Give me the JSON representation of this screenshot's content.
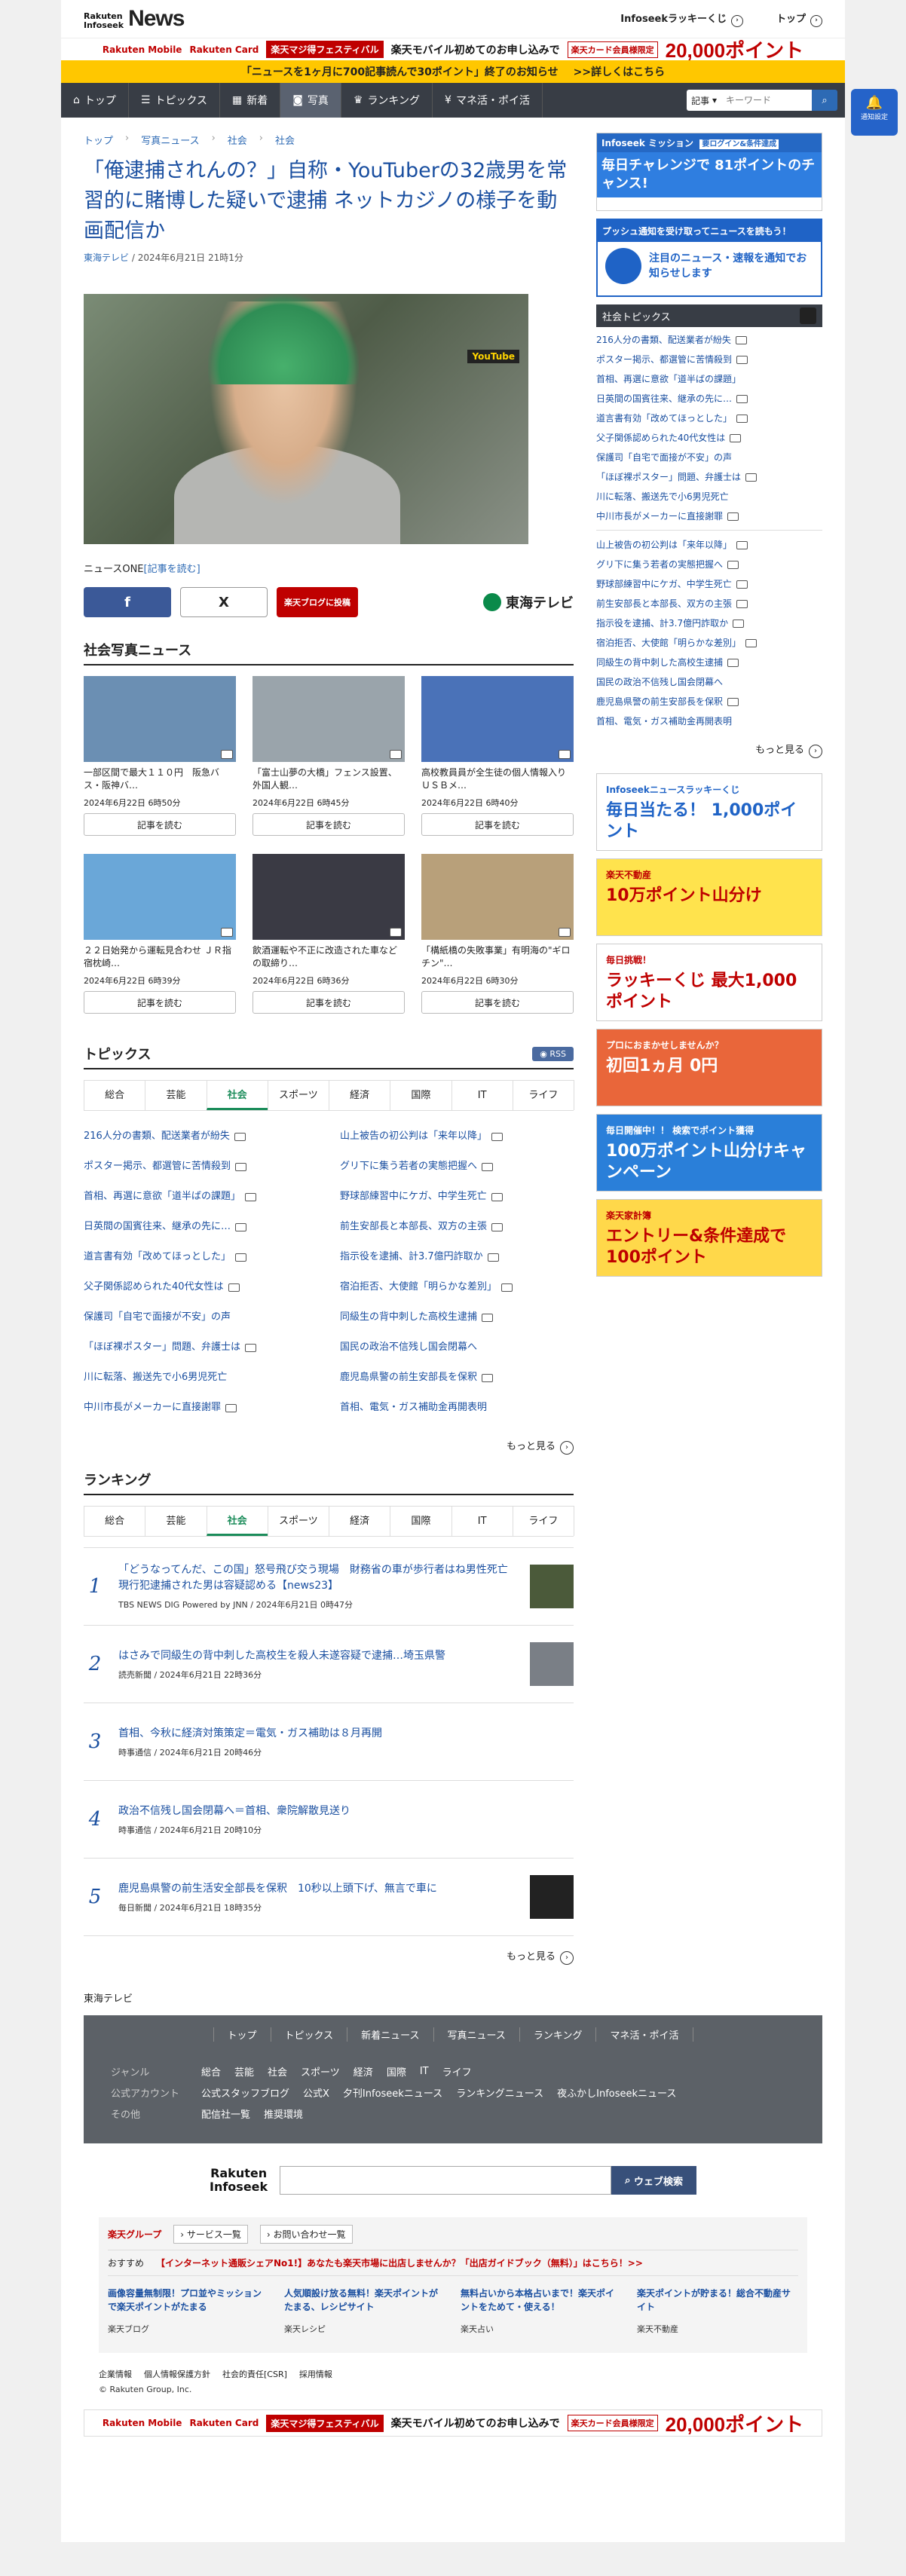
{
  "header": {
    "logo_top": "Rakuten\nInfoseek",
    "logo_news": "News",
    "kuji": "Infoseekラッキーくじ",
    "top": "トップ"
  },
  "banner": {
    "logo1": "Rakuten Mobile",
    "logo2": "Rakuten Card",
    "fest": "楽天マジ得フェスティバル",
    "text": "楽天モバイル初めてのお申し込みで",
    "box": "楽天カード会員様限定",
    "points": "20,000ポイント"
  },
  "yellowbar": {
    "text": "「ニュースを1ヶ月に700記事読んで30ポイント」終了のお知らせ",
    "link": ">>詳しくはこちら"
  },
  "nav": {
    "items": [
      "トップ",
      "トピックス",
      "新着",
      "写真",
      "ランキング",
      "マネ活・ポイ活"
    ],
    "active": 3,
    "search_select": "記事",
    "search_placeholder": "キーワード"
  },
  "notification": {
    "label": "通知設定"
  },
  "breadcrumb": [
    "トップ",
    "写真ニュース",
    "社会",
    "社会"
  ],
  "article": {
    "title": "「俺逮捕されんの？」自称・YouTuberの32歳男を常習的に賭博した疑いで逮捕 ネットカジノの様子を動画配信か",
    "source": "東海テレビ",
    "date": " / 2024年6月21日 21時1分",
    "photo_badge": "YouTube",
    "caption": "ニュースONE",
    "caption_link": "[記事を読む]",
    "share_fb": "f",
    "share_x": "X",
    "share_blog": "楽天ブログに投稿",
    "publisher": "東海テレビ"
  },
  "photo_news": {
    "heading": "社会写真ニュース",
    "read_label": "記事を読む",
    "items": [
      {
        "title": "一部区間で最大１１０円　阪急バス・阪神バ…",
        "date": "2024年6月22日 6時50分",
        "color": "#6b8fb3"
      },
      {
        "title": "「富士山夢の大橋」フェンス設置、外国人観…",
        "date": "2024年6月22日 6時45分",
        "color": "#9aa4ab"
      },
      {
        "title": "高校教員員が全生徒の個人情報入りＵＳＢメ…",
        "date": "2024年6月22日 6時40分",
        "color": "#4a72b8"
      },
      {
        "title": "２２日始発から運転見合わせ ＪＲ指宿枕崎…",
        "date": "2024年6月22日 6時39分",
        "color": "#6aa7d8"
      },
      {
        "title": "飲酒運転や不正に改造された車などの取締り…",
        "date": "2024年6月22日 6時36分",
        "color": "#3a3a44"
      },
      {
        "title": "「構紙橋の失敗事業」有明海の\"ギロチン\"…",
        "date": "2024年6月22日 6時30分",
        "color": "#b8a07a"
      }
    ]
  },
  "topics": {
    "heading": "トピックス",
    "rss": "RSS",
    "tabs": [
      "総合",
      "芸能",
      "社会",
      "スポーツ",
      "経済",
      "国際",
      "IT",
      "ライフ"
    ],
    "active_tab": 2,
    "items": [
      {
        "text": "216人分の書類、配送業者が紛失",
        "cam": true
      },
      {
        "text": "山上被告の初公判は「来年以降」",
        "cam": true
      },
      {
        "text": "ポスター掲示、都選管に苦情殺到",
        "cam": true
      },
      {
        "text": "グリ下に集う若者の実態把握へ",
        "cam": true
      },
      {
        "text": "首相、再選に意欲「道半ばの課題」",
        "cam": true
      },
      {
        "text": "野球部練習中にケガ、中学生死亡",
        "cam": true
      },
      {
        "text": "日英間の国賓往来、継承の先に…",
        "cam": true
      },
      {
        "text": "前生安部長と本部長、双方の主張",
        "cam": true
      },
      {
        "text": "道言書有効「改めてほっとした」",
        "cam": true
      },
      {
        "text": "指示役を逮捕、計3.7億円詐取か",
        "cam": true
      },
      {
        "text": "父子関係認められた40代女性は",
        "cam": true
      },
      {
        "text": "宿泊拒否、大使館「明らかな差別」",
        "cam": true
      },
      {
        "text": "保護司「自宅で面接が不安」の声",
        "cam": false
      },
      {
        "text": "同級生の背中刺した高校生逮捕",
        "cam": true
      },
      {
        "text": "「ほぼ裸ポスター」問題、弁護士は",
        "cam": true
      },
      {
        "text": "国民の政治不信残し国会閉幕へ",
        "cam": false
      },
      {
        "text": "川に転落、搬送先で小6男児死亡",
        "cam": false
      },
      {
        "text": "鹿児島県警の前生安部長を保釈",
        "cam": true
      },
      {
        "text": "中川市長がメーカーに直接謝罪",
        "cam": true
      },
      {
        "text": "首相、電気・ガス補助金再開表明",
        "cam": false
      }
    ],
    "more": "もっと見る"
  },
  "ranking": {
    "heading": "ランキング",
    "tabs": [
      "総合",
      "芸能",
      "社会",
      "スポーツ",
      "経済",
      "国際",
      "IT",
      "ライフ"
    ],
    "active_tab": 2,
    "items": [
      {
        "rank": "1",
        "title": "「どうなってんだ、この国」怒号飛び交う現場　財務省の車が歩行者はね男性死亡　現行犯逮捕された男は容疑認める【news23】",
        "meta": "TBS NEWS DIG Powered by JNN / 2024年6月21日 0時47分",
        "thumb": "#4b5a3a"
      },
      {
        "rank": "2",
        "title": "はさみで同級生の背中刺した高校生を殺人未遂容疑で逮捕…埼玉県警",
        "meta": "読売新聞 / 2024年6月21日 22時36分",
        "thumb": "#7a7f86"
      },
      {
        "rank": "3",
        "title": "首相、今秋に経済対策策定＝電気・ガス補助は８月再開",
        "meta": "時事通信 / 2024年6月21日 20時46分",
        "thumb": ""
      },
      {
        "rank": "4",
        "title": "政治不信残し国会閉幕へ＝首相、衆院解散見送り",
        "meta": "時事通信 / 2024年6月21日 20時10分",
        "thumb": ""
      },
      {
        "rank": "5",
        "title": "鹿児島県警の前生活安全部長を保釈　10秒以上頭下げ、無言で車に",
        "meta": "毎日新聞 / 2024年6月21日 18時35分",
        "thumb": "#222"
      }
    ],
    "more": "もっと見る"
  },
  "source_footer": "東海テレビ",
  "sidebar": {
    "ad1_top": "Infoseek ミッション",
    "ad1_badge": "要ログイン&条件達成",
    "ad1_main": "毎日チャレンジで 81ポイントのチャンス!",
    "ad2_top": "プッシュ通知を受け取ってニュースを読もう！",
    "ad2_main": "注目のニュース・速報を通知でお知らせします",
    "topics_heading": "社会トピックス",
    "topics": [
      "216人分の書類、配送業者が紛失",
      "ポスター掲示、都選管に苦情殺到",
      "首相、再選に意欲「道半ばの課題」",
      "日英間の国賓往来、継承の先に…",
      "道言書有効「改めてほっとした」",
      "父子関係認められた40代女性は",
      "保護司「自宅で面接が不安」の声",
      "「ほぼ裸ポスター」問題、弁護士は",
      "川に転落、搬送先で小6男児死亡",
      "中川市長がメーカーに直接謝罪",
      "山上被告の初公判は「来年以降」",
      "グリ下に集う若者の実態把握へ",
      "野球部練習中にケガ、中学生死亡",
      "前生安部長と本部長、双方の主張",
      "指示役を逮捕、計3.7億円詐取か",
      "宿泊拒否、大使館「明らかな差別」",
      "同級生の背中刺した高校生逮捕",
      "国民の政治不信残し国会閉幕へ",
      "鹿児島県警の前生安部長を保釈",
      "首相、電気・ガス補助金再開表明"
    ],
    "topics_cam": [
      true,
      true,
      false,
      true,
      true,
      true,
      false,
      true,
      false,
      true,
      true,
      true,
      true,
      true,
      true,
      true,
      true,
      false,
      true,
      false
    ],
    "more": "もっと見る",
    "ads": [
      {
        "main": "毎日当たる！ 1,000ポイント",
        "sub": "Infoseekニュースラッキーくじ",
        "bg": "#fff",
        "fg": "#1f63c6"
      },
      {
        "main": "10万ポイント山分け",
        "sub": "楽天不動産",
        "bg": "#ffe34d",
        "fg": "#bf0000"
      },
      {
        "main": "ラッキーくじ 最大1,000ポイント",
        "sub": "毎日挑戦！",
        "bg": "#fff",
        "fg": "#bf0000"
      },
      {
        "main": "初回1ヵ月 0円",
        "sub": "プロにおまかせしませんか？",
        "bg": "#e9663a",
        "fg": "#fff"
      },
      {
        "main": "100万ポイント山分けキャンペーン",
        "sub": "毎日開催中！！ 検索でポイント獲得",
        "bg": "#2a7fd9",
        "fg": "#fff"
      },
      {
        "main": "エントリー&条件達成で 100ポイント",
        "sub": "楽天家計簿",
        "bg": "#ffd84a",
        "fg": "#bf0000"
      }
    ]
  },
  "footer": {
    "nav": [
      "トップ",
      "トピックス",
      "新着ニュース",
      "写真ニュース",
      "ランキング",
      "マネ活・ポイ活"
    ],
    "rows": [
      {
        "label": "ジャンル",
        "items": [
          "総合",
          "芸能",
          "社会",
          "スポーツ",
          "経済",
          "国際",
          "IT",
          "ライフ"
        ]
      },
      {
        "label": "公式アカウント",
        "items": [
          "公式スタッフブログ",
          "公式X",
          "夕刊Infoseekニュース",
          "ランキングニュース",
          "夜ふかしInfoseekニュース"
        ]
      },
      {
        "label": "その他",
        "items": [
          "配信社一覧",
          "推奨環境"
        ]
      }
    ],
    "search_logo": "Rakuten\nInfoseek",
    "search_btn": "ウェブ検索",
    "group": "楽天グループ",
    "service": "サービス一覧",
    "contact": "お問い合わせ一覧",
    "recommend_label": "おすすめ",
    "recommend": "【インターネット通販シェアNo1!】あなたも楽天市場に出店しませんか？「出店ガイドブック（無料）」はこちら！>>",
    "promos": [
      {
        "t": "画像容量無制限！プロ並やミッションで楽天ポイントがたまる",
        "s": "楽天ブログ"
      },
      {
        "t": "人気順設け放る無料！楽天ポイントがたまる、レシピサイト",
        "s": "楽天レシピ"
      },
      {
        "t": "無料占いから本格占いまで！楽天ポイントをためて・使える！",
        "s": "楽天占い"
      },
      {
        "t": "楽天ポイントが貯まる！総合不動産サイト",
        "s": "楽天不動産"
      }
    ],
    "legal": [
      "企業情報",
      "個人情報保護方針",
      "社会的責任[CSR]",
      "採用情報"
    ],
    "copyright": "© Rakuten Group, Inc."
  }
}
